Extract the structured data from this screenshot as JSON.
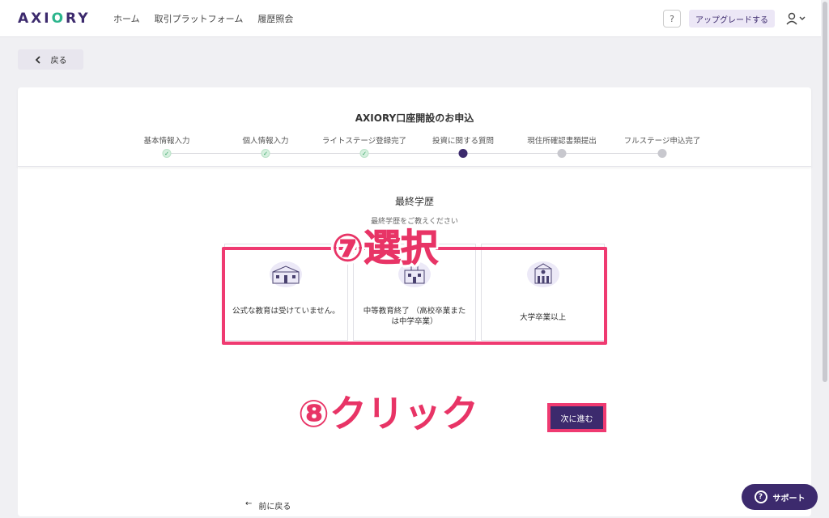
{
  "header": {
    "logo": "AXIORY",
    "nav": [
      "ホーム",
      "取引プラットフォーム",
      "履歴照会"
    ],
    "help_icon": "?",
    "upgrade_label": "アップグレードする"
  },
  "back_label": "戻る",
  "form": {
    "title": "AXIORY口座開設のお申込",
    "steps": [
      {
        "label": "基本情報入力",
        "state": "done"
      },
      {
        "label": "個人情報入力",
        "state": "done"
      },
      {
        "label": "ライトステージ登録完了",
        "state": "done"
      },
      {
        "label": "投資に関する質問",
        "state": "active"
      },
      {
        "label": "現住所確認書類提出",
        "state": "todo"
      },
      {
        "label": "フルステージ申込完了",
        "state": "todo"
      }
    ],
    "question": "最終学歴",
    "question_sub": "最終学歴をご教えください",
    "options": [
      "公式な教育は受けていません。",
      "中等教育終了 （高校卒業または中学卒業）",
      "大学卒業以上"
    ],
    "prev_label": "前に戻る",
    "next_label": "次に進む"
  },
  "annotations": {
    "step7": "⑦選択",
    "step8": "⑧クリック"
  },
  "support_label": "サポート",
  "colors": {
    "brand": "#3c2a6d",
    "accent_green": "#2bb58c",
    "annotation": "#ef3a71"
  }
}
